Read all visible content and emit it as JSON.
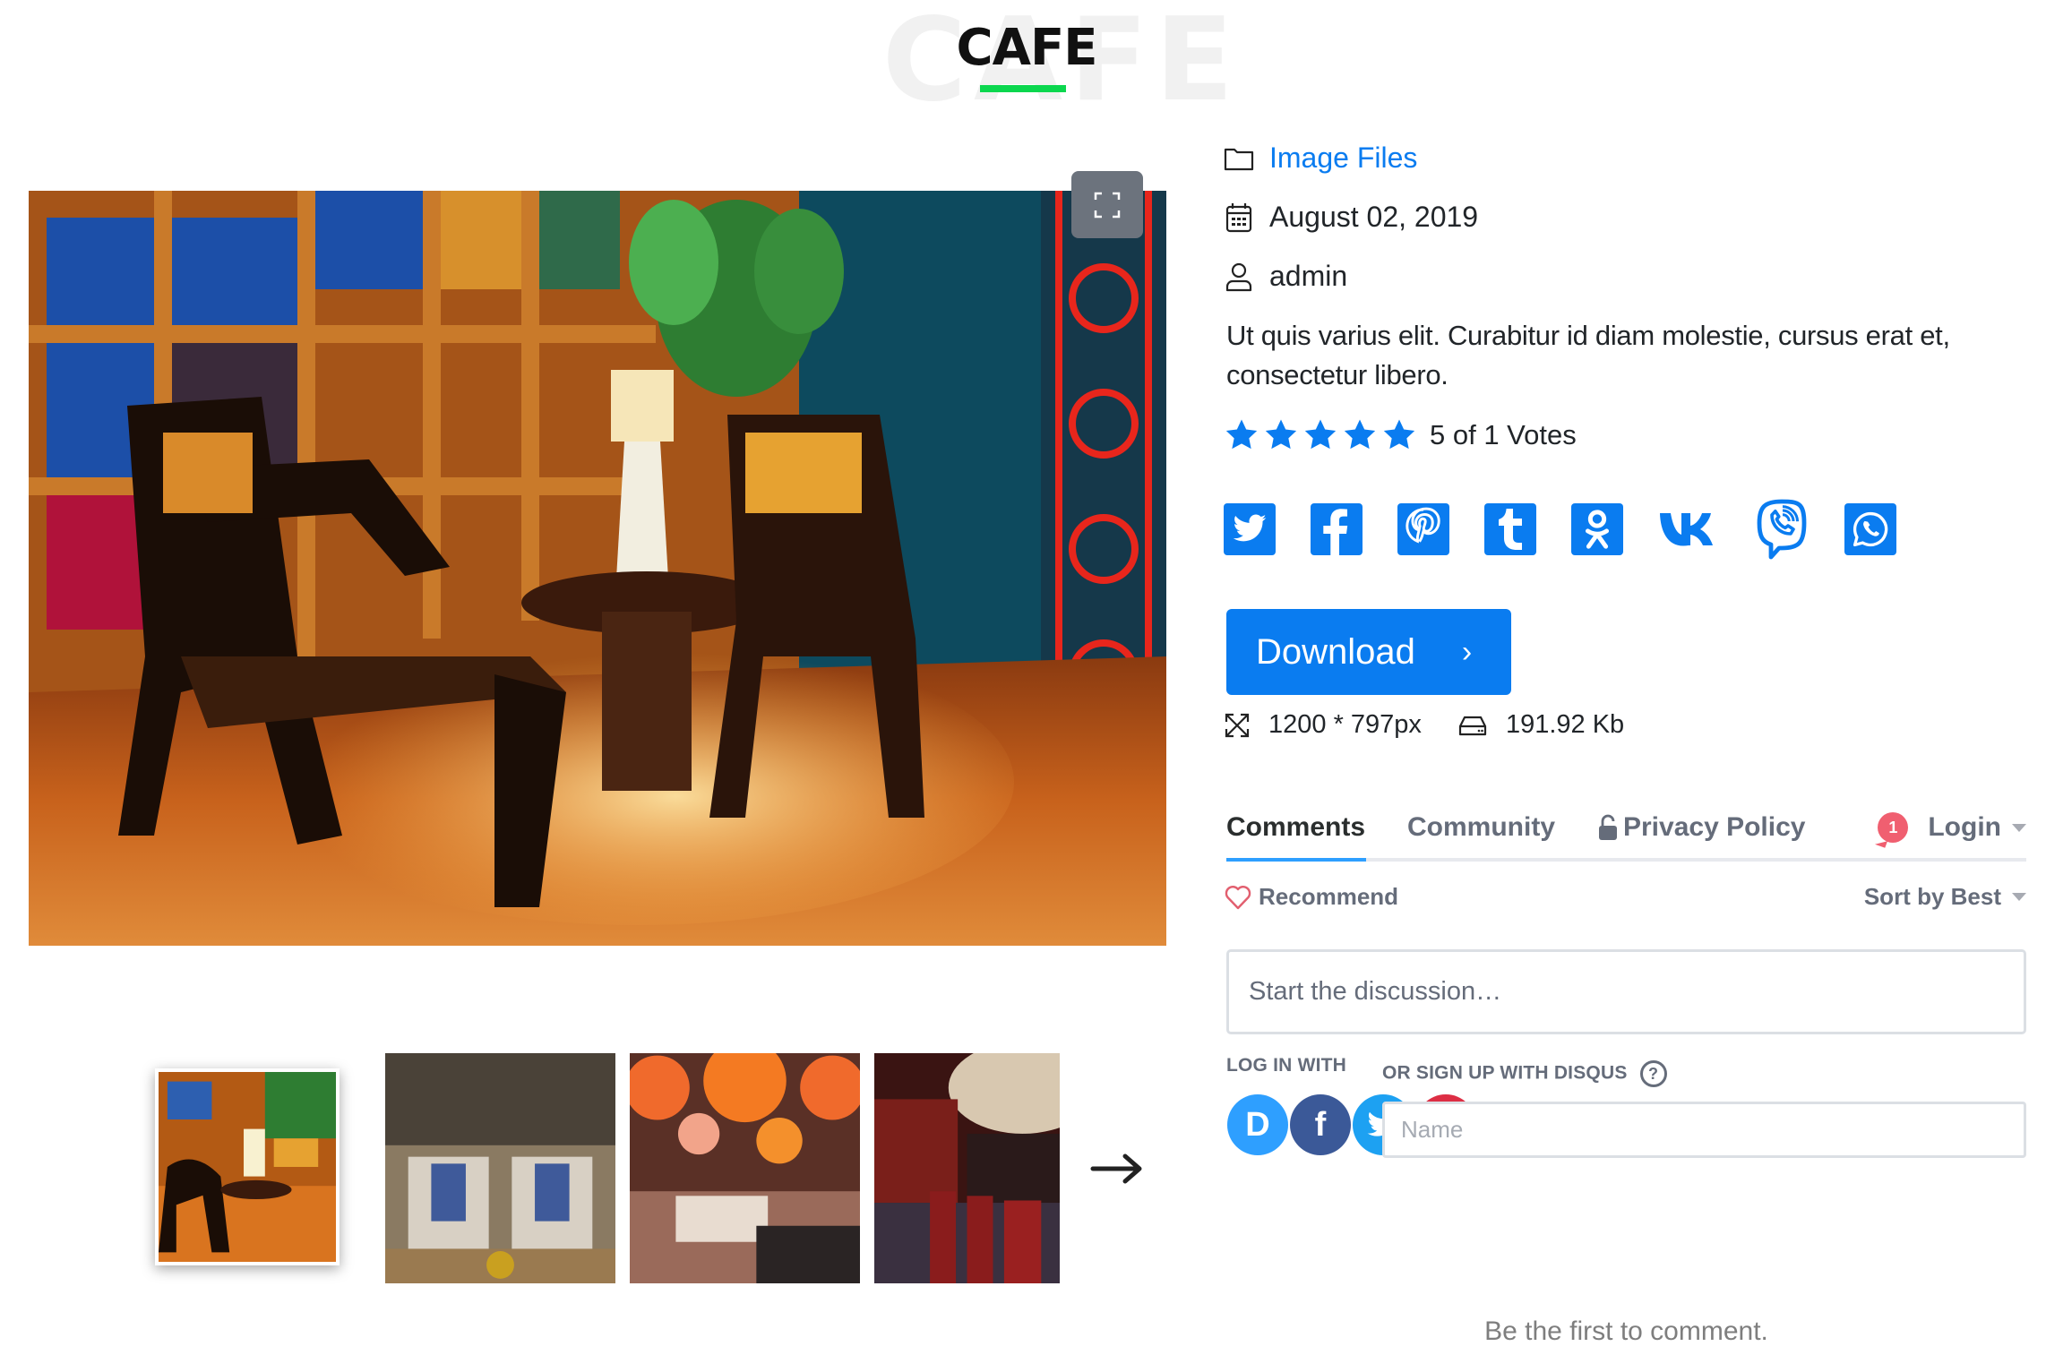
{
  "header": {
    "title": "CAFE",
    "background_title": "CAFE",
    "accent_color": "#0bd74e"
  },
  "gallery": {
    "main_image_alt": "Cafe interior with carved wooden chairs, lamp and round table",
    "fullscreen_icon": "fullscreen-icon",
    "thumbnails": [
      {
        "alt": "Cafe interior with chairs and lamp",
        "active": true
      },
      {
        "alt": "Lounge with LOVE pillows on armchairs",
        "active": false
      },
      {
        "alt": "Restaurant with orange paper lanterns",
        "active": false
      },
      {
        "alt": "Bar with red stools",
        "active": false
      }
    ],
    "next_icon": "arrow-right-icon"
  },
  "details": {
    "category": {
      "icon": "folder-icon",
      "label": "Image Files"
    },
    "date": {
      "icon": "calendar-icon",
      "label": "August 02, 2019"
    },
    "author": {
      "icon": "user-icon",
      "label": "admin"
    },
    "description": "Ut quis varius elit. Curabitur id diam molestie, cursus erat et, consectetur libero.",
    "rating": {
      "value": 5,
      "max": 5,
      "text": "5 of 1 Votes"
    },
    "share": [
      {
        "name": "twitter",
        "icon": "twitter-icon"
      },
      {
        "name": "facebook",
        "icon": "facebook-icon"
      },
      {
        "name": "pinterest",
        "icon": "pinterest-icon"
      },
      {
        "name": "tumblr",
        "icon": "tumblr-icon"
      },
      {
        "name": "odnoklassniki",
        "icon": "odnoklassniki-icon"
      },
      {
        "name": "vk",
        "icon": "vk-icon"
      },
      {
        "name": "viber",
        "icon": "viber-icon"
      },
      {
        "name": "whatsapp",
        "icon": "whatsapp-icon"
      }
    ],
    "download_label": "Download",
    "download_chevron": "›",
    "dimensions": "1200 * 797px",
    "filesize": "191.92 Kb",
    "accent_color": "#0a7cf0"
  },
  "disqus": {
    "tabs": [
      {
        "label": "Comments",
        "active": true
      },
      {
        "label": "Community",
        "active": false
      },
      {
        "label": "Privacy Policy",
        "active": false
      }
    ],
    "login": {
      "label": "Login",
      "badge": "1"
    },
    "recommend_label": "Recommend",
    "sort_label": "Sort by Best",
    "textarea_placeholder": "Start the discussion…",
    "log_in_with_label": "LOG IN WITH",
    "sign_up_label": "OR SIGN UP WITH DISQUS",
    "help_glyph": "?",
    "login_providers": [
      {
        "name": "disqus",
        "glyph": "D",
        "color": "#2e9fff"
      },
      {
        "name": "facebook",
        "glyph": "f",
        "color": "#3b5998"
      },
      {
        "name": "twitter",
        "glyph": "t",
        "color": "#1da1f2"
      },
      {
        "name": "google",
        "glyph": "G",
        "color": "#dd4b39"
      }
    ],
    "name_placeholder": "Name",
    "empty_text": "Be the first to comment."
  }
}
